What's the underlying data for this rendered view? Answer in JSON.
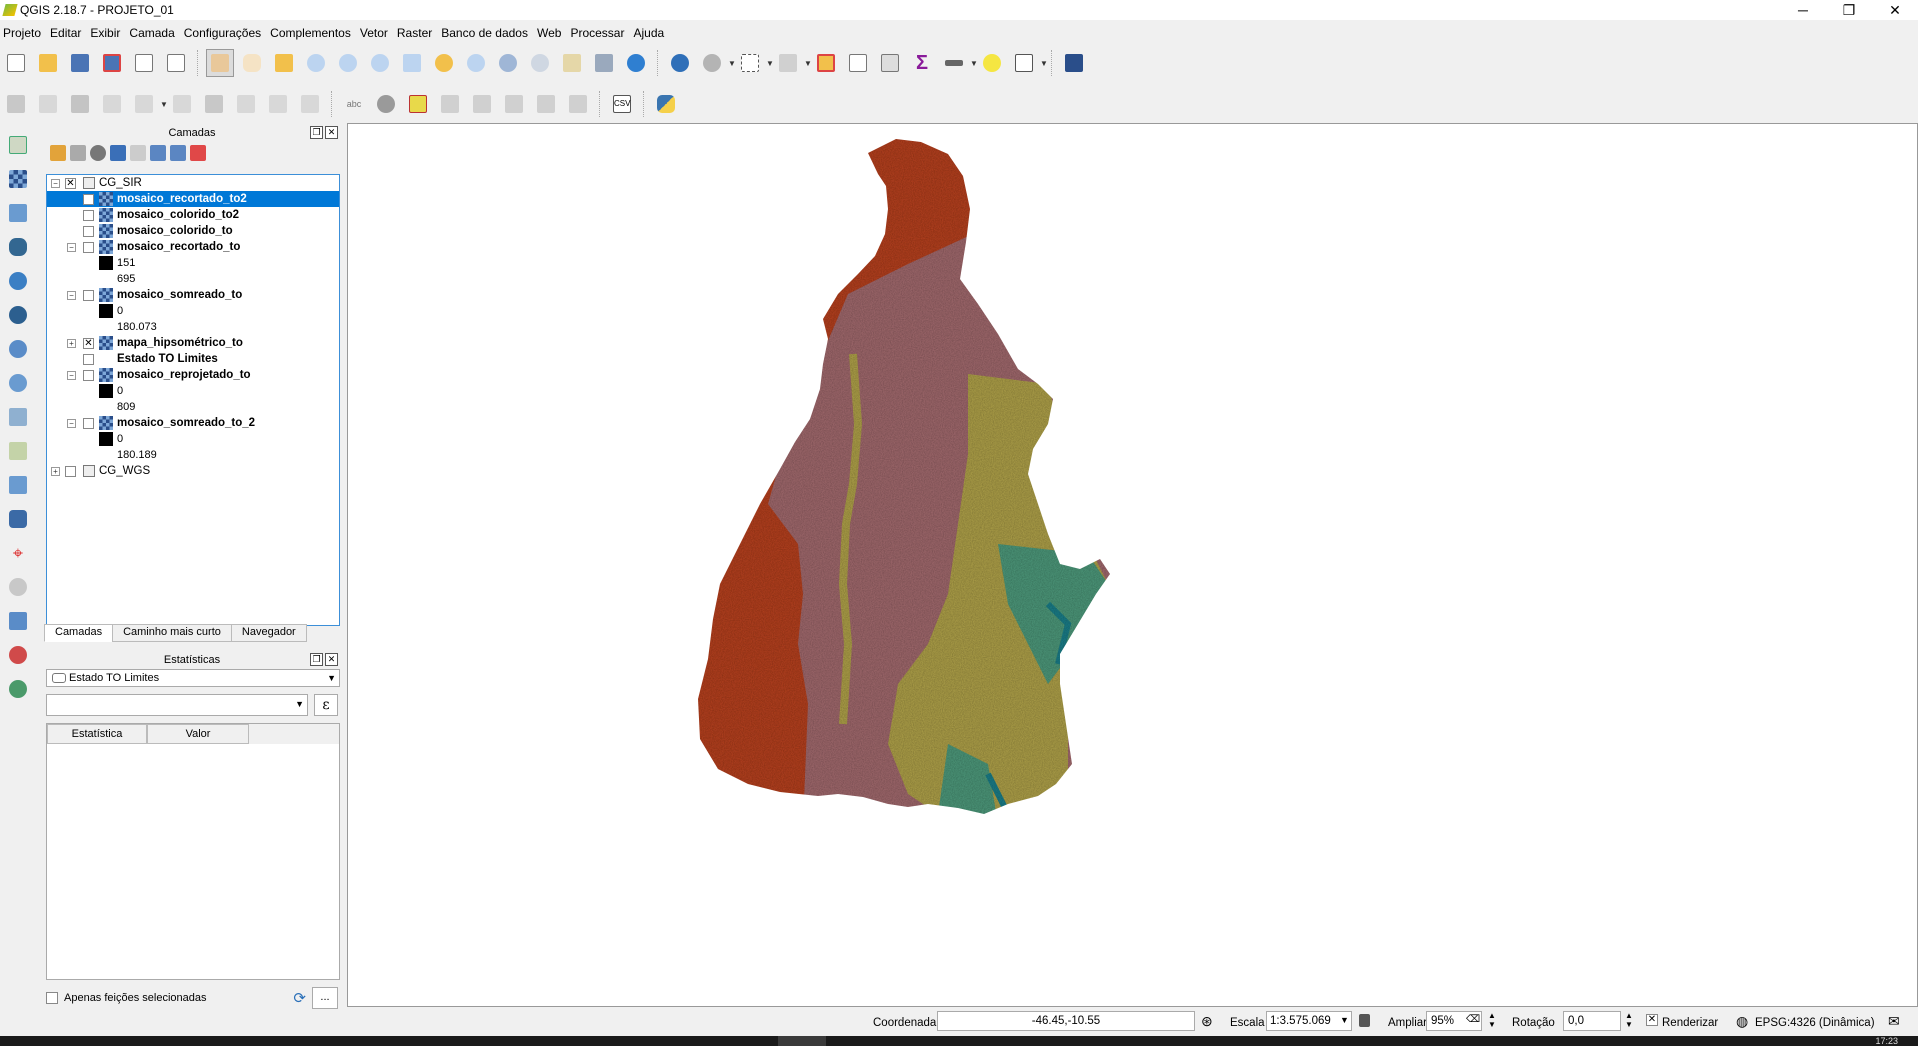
{
  "window": {
    "title": "QGIS 2.18.7 - PROJETO_01",
    "minimize": "─",
    "restore": "❐",
    "close": "✕"
  },
  "menu": [
    "Projeto",
    "Editar",
    "Exibir",
    "Camada",
    "Configurações",
    "Complementos",
    "Vetor",
    "Raster",
    "Banco de dados",
    "Web",
    "Processar",
    "Ajuda"
  ],
  "toolbar2": {
    "csv_label": "CSV",
    "abc_label": "abc"
  },
  "layers_panel": {
    "title": "Camadas",
    "tree": [
      {
        "label": "CG_SIR",
        "kind": "group"
      },
      {
        "label": "mosaico_recortado_to2",
        "kind": "raster",
        "checked": true,
        "selected": true
      },
      {
        "label": "mosaico_colorido_to2",
        "kind": "raster"
      },
      {
        "label": "mosaico_colorido_to",
        "kind": "raster"
      },
      {
        "label": "mosaico_recortado_to",
        "kind": "raster",
        "expanded": true
      },
      {
        "label": "151",
        "kind": "legend"
      },
      {
        "label": "695",
        "kind": "legend-value"
      },
      {
        "label": "mosaico_somreado_to",
        "kind": "raster",
        "expanded": true
      },
      {
        "label": "0",
        "kind": "legend"
      },
      {
        "label": "180.073",
        "kind": "legend-value"
      },
      {
        "label": "mapa_hipsométrico_to",
        "kind": "raster",
        "checked": true,
        "collapsed": true
      },
      {
        "label": "Estado TO Limites",
        "kind": "vector"
      },
      {
        "label": "mosaico_reprojetado_to",
        "kind": "raster",
        "expanded": true
      },
      {
        "label": "0",
        "kind": "legend"
      },
      {
        "label": "809",
        "kind": "legend-value"
      },
      {
        "label": "mosaico_somreado_to_2",
        "kind": "raster",
        "expanded": true
      },
      {
        "label": "0",
        "kind": "legend"
      },
      {
        "label": "180.189",
        "kind": "legend-value"
      },
      {
        "label": "CG_WGS",
        "kind": "group"
      }
    ]
  },
  "tabs": [
    "Camadas",
    "Caminho mais curto",
    "Navegador"
  ],
  "stats_panel": {
    "title": "Estatísticas",
    "layer": "Estado TO Limites",
    "field": "",
    "expr_symbol": "ε",
    "columns": [
      "Estatística",
      "Valor"
    ],
    "only_selected": "Apenas feições selecionadas",
    "more_button": "..."
  },
  "map": {
    "colors": {
      "highlands": "#b7411f",
      "plateau": "#a26a6e",
      "valley": "#b0a24a",
      "lowland": "#4e9a7c",
      "water": "#1b7f8a"
    }
  },
  "status": {
    "coord_label": "Coordenada",
    "coord_value": "-46.45,-10.55",
    "scale_label": "Escala",
    "scale_value": "1:3.575.069",
    "magnify_label": "Ampliar",
    "magnify_value": "95%",
    "rotation_label": "Rotação",
    "rotation_value": "0,0",
    "render_label": "Renderizar",
    "crs": "EPSG:4326 (Dinâmica)"
  },
  "taskbar": {
    "clock": "17:23"
  }
}
